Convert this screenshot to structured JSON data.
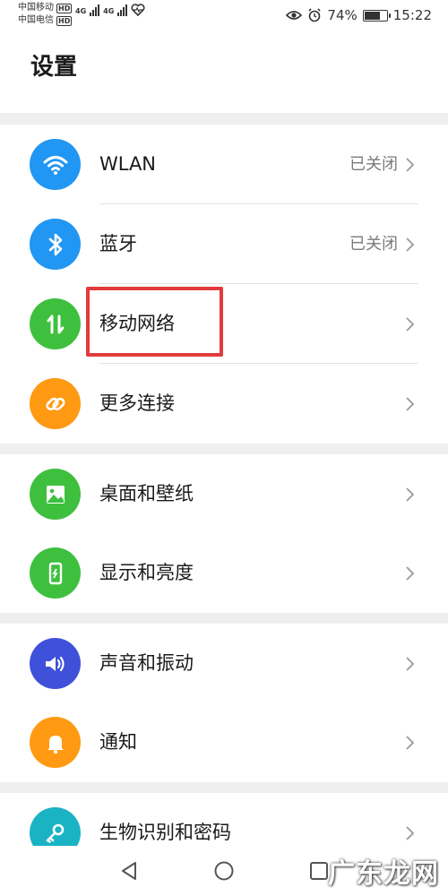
{
  "status_bar": {
    "carrier1": "中国移动",
    "carrier2": "中国电信",
    "hd_badge": "HD",
    "network_label": "4G",
    "battery_text": "74%",
    "time": "15:22"
  },
  "page_title": "设置",
  "groups": [
    {
      "items": [
        {
          "label": "WLAN",
          "value": "已关闭",
          "icon": "wifi-icon",
          "color": "#2196f3"
        },
        {
          "label": "蓝牙",
          "value": "已关闭",
          "icon": "bluetooth-icon",
          "color": "#2196f3"
        },
        {
          "label": "移动网络",
          "value": "",
          "icon": "mobile-data-icon",
          "color": "#3ec03e"
        },
        {
          "label": "更多连接",
          "value": "",
          "icon": "link-icon",
          "color": "#ff9a12"
        }
      ]
    },
    {
      "items": [
        {
          "label": "桌面和壁纸",
          "value": "",
          "icon": "wallpaper-icon",
          "color": "#3ec03e"
        },
        {
          "label": "显示和亮度",
          "value": "",
          "icon": "display-icon",
          "color": "#3ec03e"
        }
      ]
    },
    {
      "items": [
        {
          "label": "声音和振动",
          "value": "",
          "icon": "speaker-icon",
          "color": "#3f51d8"
        },
        {
          "label": "通知",
          "value": "",
          "icon": "bell-icon",
          "color": "#ff9a12"
        }
      ]
    },
    {
      "items": [
        {
          "label": "生物识别和密码",
          "value": "",
          "icon": "key-icon",
          "color": "#19b3c4"
        }
      ]
    }
  ],
  "watermark": "广东龙网"
}
